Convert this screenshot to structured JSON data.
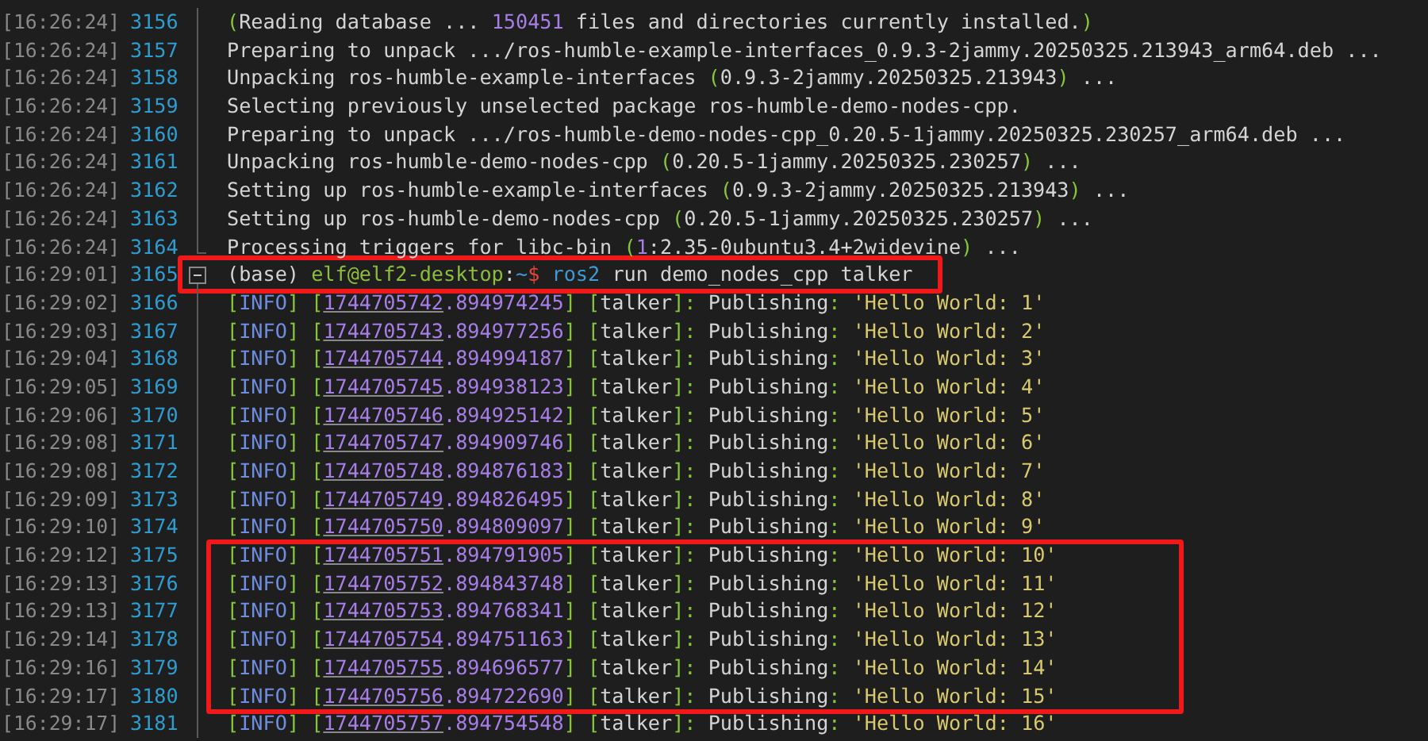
{
  "lines": [
    {
      "time": "[16:26:24]",
      "number": "3156",
      "kind": "plain",
      "segments": [
        {
          "kind": "punct",
          "text": "("
        },
        {
          "kind": "plain",
          "text": "Reading database ... "
        },
        {
          "kind": "number",
          "text": "150451"
        },
        {
          "kind": "plain",
          "text": " files and directories currently installed."
        },
        {
          "kind": "punct",
          "text": ")"
        }
      ]
    },
    {
      "time": "[16:26:24]",
      "number": "3157",
      "kind": "plain",
      "segments": [
        {
          "kind": "plain",
          "text": "Preparing to unpack .../ros-humble-example-interfaces_0.9.3-2jammy.20250325.213943_arm64.deb ..."
        }
      ]
    },
    {
      "time": "[16:26:24]",
      "number": "3158",
      "kind": "plain",
      "segments": [
        {
          "kind": "plain",
          "text": "Unpacking ros-humble-example-interfaces "
        },
        {
          "kind": "punct",
          "text": "("
        },
        {
          "kind": "plain",
          "text": "0.9.3-2jammy.20250325.213943"
        },
        {
          "kind": "punct",
          "text": ")"
        },
        {
          "kind": "plain",
          "text": " ..."
        }
      ]
    },
    {
      "time": "[16:26:24]",
      "number": "3159",
      "kind": "plain",
      "segments": [
        {
          "kind": "plain",
          "text": "Selecting previously unselected package ros-humble-demo-nodes-cpp."
        }
      ]
    },
    {
      "time": "[16:26:24]",
      "number": "3160",
      "kind": "plain",
      "segments": [
        {
          "kind": "plain",
          "text": "Preparing to unpack .../ros-humble-demo-nodes-cpp_0.20.5-1jammy.20250325.230257_arm64.deb ..."
        }
      ]
    },
    {
      "time": "[16:26:24]",
      "number": "3161",
      "kind": "plain",
      "segments": [
        {
          "kind": "plain",
          "text": "Unpacking ros-humble-demo-nodes-cpp "
        },
        {
          "kind": "punct",
          "text": "("
        },
        {
          "kind": "plain",
          "text": "0.20.5-1jammy.20250325.230257"
        },
        {
          "kind": "punct",
          "text": ")"
        },
        {
          "kind": "plain",
          "text": " ..."
        }
      ]
    },
    {
      "time": "[16:26:24]",
      "number": "3162",
      "kind": "plain",
      "segments": [
        {
          "kind": "plain",
          "text": "Setting up ros-humble-example-interfaces "
        },
        {
          "kind": "punct",
          "text": "("
        },
        {
          "kind": "plain",
          "text": "0.9.3-2jammy.20250325.213943"
        },
        {
          "kind": "punct",
          "text": ")"
        },
        {
          "kind": "plain",
          "text": " ..."
        }
      ]
    },
    {
      "time": "[16:26:24]",
      "number": "3163",
      "kind": "plain",
      "segments": [
        {
          "kind": "plain",
          "text": "Setting up ros-humble-demo-nodes-cpp "
        },
        {
          "kind": "punct",
          "text": "("
        },
        {
          "kind": "plain",
          "text": "0.20.5-1jammy.20250325.230257"
        },
        {
          "kind": "punct",
          "text": ")"
        },
        {
          "kind": "plain",
          "text": " ..."
        }
      ]
    },
    {
      "time": "[16:26:24]",
      "number": "3164",
      "kind": "closing",
      "segments": [
        {
          "kind": "plain",
          "text": "Processing triggers for libc-bin "
        },
        {
          "kind": "punct",
          "text": "("
        },
        {
          "kind": "number",
          "text": "1"
        },
        {
          "kind": "plain",
          "text": ":2.35-0ubuntu3.4+2widevine"
        },
        {
          "kind": "punct",
          "text": ")"
        },
        {
          "kind": "plain",
          "text": " ..."
        }
      ]
    },
    {
      "time": "[16:29:01]",
      "number": "3165",
      "kind": "opening",
      "segments": [
        {
          "kind": "plain",
          "text": "(base) "
        },
        {
          "kind": "user",
          "text": "elf@elf2-desktop"
        },
        {
          "kind": "plain",
          "text": ":"
        },
        {
          "kind": "command",
          "text": "~"
        },
        {
          "kind": "dollar",
          "text": "$ "
        },
        {
          "kind": "command",
          "text": "ros2"
        },
        {
          "kind": "plain",
          "text": " run demo_nodes_cpp talker"
        }
      ]
    },
    {
      "time": "[16:29:02]",
      "number": "3166",
      "kind": "plain",
      "segments": [
        {
          "kind": "punct",
          "text": "["
        },
        {
          "kind": "info",
          "text": "INFO"
        },
        {
          "kind": "punct",
          "text": "] ["
        },
        {
          "kind": "link",
          "text": "1744705742"
        },
        {
          "kind": "number",
          "text": ".894974245"
        },
        {
          "kind": "punct",
          "text": "] ["
        },
        {
          "kind": "plain",
          "text": "talker"
        },
        {
          "kind": "punct",
          "text": "]:"
        },
        {
          "kind": "plain",
          "text": " Publishing"
        },
        {
          "kind": "punct",
          "text": ": "
        },
        {
          "kind": "string",
          "text": "'Hello World: 1'"
        }
      ]
    },
    {
      "time": "[16:29:03]",
      "number": "3167",
      "kind": "plain",
      "segments": [
        {
          "kind": "punct",
          "text": "["
        },
        {
          "kind": "info",
          "text": "INFO"
        },
        {
          "kind": "punct",
          "text": "] ["
        },
        {
          "kind": "link",
          "text": "1744705743"
        },
        {
          "kind": "number",
          "text": ".894977256"
        },
        {
          "kind": "punct",
          "text": "] ["
        },
        {
          "kind": "plain",
          "text": "talker"
        },
        {
          "kind": "punct",
          "text": "]:"
        },
        {
          "kind": "plain",
          "text": " Publishing"
        },
        {
          "kind": "punct",
          "text": ": "
        },
        {
          "kind": "string",
          "text": "'Hello World: 2'"
        }
      ]
    },
    {
      "time": "[16:29:04]",
      "number": "3168",
      "kind": "plain",
      "segments": [
        {
          "kind": "punct",
          "text": "["
        },
        {
          "kind": "info",
          "text": "INFO"
        },
        {
          "kind": "punct",
          "text": "] ["
        },
        {
          "kind": "link",
          "text": "1744705744"
        },
        {
          "kind": "number",
          "text": ".894994187"
        },
        {
          "kind": "punct",
          "text": "] ["
        },
        {
          "kind": "plain",
          "text": "talker"
        },
        {
          "kind": "punct",
          "text": "]:"
        },
        {
          "kind": "plain",
          "text": " Publishing"
        },
        {
          "kind": "punct",
          "text": ": "
        },
        {
          "kind": "string",
          "text": "'Hello World: 3'"
        }
      ]
    },
    {
      "time": "[16:29:05]",
      "number": "3169",
      "kind": "plain",
      "segments": [
        {
          "kind": "punct",
          "text": "["
        },
        {
          "kind": "info",
          "text": "INFO"
        },
        {
          "kind": "punct",
          "text": "] ["
        },
        {
          "kind": "link",
          "text": "1744705745"
        },
        {
          "kind": "number",
          "text": ".894938123"
        },
        {
          "kind": "punct",
          "text": "] ["
        },
        {
          "kind": "plain",
          "text": "talker"
        },
        {
          "kind": "punct",
          "text": "]:"
        },
        {
          "kind": "plain",
          "text": " Publishing"
        },
        {
          "kind": "punct",
          "text": ": "
        },
        {
          "kind": "string",
          "text": "'Hello World: 4'"
        }
      ]
    },
    {
      "time": "[16:29:06]",
      "number": "3170",
      "kind": "plain",
      "segments": [
        {
          "kind": "punct",
          "text": "["
        },
        {
          "kind": "info",
          "text": "INFO"
        },
        {
          "kind": "punct",
          "text": "] ["
        },
        {
          "kind": "link",
          "text": "1744705746"
        },
        {
          "kind": "number",
          "text": ".894925142"
        },
        {
          "kind": "punct",
          "text": "] ["
        },
        {
          "kind": "plain",
          "text": "talker"
        },
        {
          "kind": "punct",
          "text": "]:"
        },
        {
          "kind": "plain",
          "text": " Publishing"
        },
        {
          "kind": "punct",
          "text": ": "
        },
        {
          "kind": "string",
          "text": "'Hello World: 5'"
        }
      ]
    },
    {
      "time": "[16:29:08]",
      "number": "3171",
      "kind": "plain",
      "segments": [
        {
          "kind": "punct",
          "text": "["
        },
        {
          "kind": "info",
          "text": "INFO"
        },
        {
          "kind": "punct",
          "text": "] ["
        },
        {
          "kind": "link",
          "text": "1744705747"
        },
        {
          "kind": "number",
          "text": ".894909746"
        },
        {
          "kind": "punct",
          "text": "] ["
        },
        {
          "kind": "plain",
          "text": "talker"
        },
        {
          "kind": "punct",
          "text": "]:"
        },
        {
          "kind": "plain",
          "text": " Publishing"
        },
        {
          "kind": "punct",
          "text": ": "
        },
        {
          "kind": "string",
          "text": "'Hello World: 6'"
        }
      ]
    },
    {
      "time": "[16:29:08]",
      "number": "3172",
      "kind": "plain",
      "segments": [
        {
          "kind": "punct",
          "text": "["
        },
        {
          "kind": "info",
          "text": "INFO"
        },
        {
          "kind": "punct",
          "text": "] ["
        },
        {
          "kind": "link",
          "text": "1744705748"
        },
        {
          "kind": "number",
          "text": ".894876183"
        },
        {
          "kind": "punct",
          "text": "] ["
        },
        {
          "kind": "plain",
          "text": "talker"
        },
        {
          "kind": "punct",
          "text": "]:"
        },
        {
          "kind": "plain",
          "text": " Publishing"
        },
        {
          "kind": "punct",
          "text": ": "
        },
        {
          "kind": "string",
          "text": "'Hello World: 7'"
        }
      ]
    },
    {
      "time": "[16:29:09]",
      "number": "3173",
      "kind": "plain",
      "segments": [
        {
          "kind": "punct",
          "text": "["
        },
        {
          "kind": "info",
          "text": "INFO"
        },
        {
          "kind": "punct",
          "text": "] ["
        },
        {
          "kind": "link",
          "text": "1744705749"
        },
        {
          "kind": "number",
          "text": ".894826495"
        },
        {
          "kind": "punct",
          "text": "] ["
        },
        {
          "kind": "plain",
          "text": "talker"
        },
        {
          "kind": "punct",
          "text": "]:"
        },
        {
          "kind": "plain",
          "text": " Publishing"
        },
        {
          "kind": "punct",
          "text": ": "
        },
        {
          "kind": "string",
          "text": "'Hello World: 8'"
        }
      ]
    },
    {
      "time": "[16:29:10]",
      "number": "3174",
      "kind": "plain",
      "segments": [
        {
          "kind": "punct",
          "text": "["
        },
        {
          "kind": "info",
          "text": "INFO"
        },
        {
          "kind": "punct",
          "text": "] ["
        },
        {
          "kind": "link",
          "text": "1744705750"
        },
        {
          "kind": "number",
          "text": ".894809097"
        },
        {
          "kind": "punct",
          "text": "] ["
        },
        {
          "kind": "plain",
          "text": "talker"
        },
        {
          "kind": "punct",
          "text": "]:"
        },
        {
          "kind": "plain",
          "text": " Publishing"
        },
        {
          "kind": "punct",
          "text": ": "
        },
        {
          "kind": "string",
          "text": "'Hello World: 9'"
        }
      ]
    },
    {
      "time": "[16:29:12]",
      "number": "3175",
      "kind": "plain",
      "segments": [
        {
          "kind": "punct",
          "text": "["
        },
        {
          "kind": "info",
          "text": "INFO"
        },
        {
          "kind": "punct",
          "text": "] ["
        },
        {
          "kind": "link",
          "text": "1744705751"
        },
        {
          "kind": "number",
          "text": ".894791905"
        },
        {
          "kind": "punct",
          "text": "] ["
        },
        {
          "kind": "plain",
          "text": "talker"
        },
        {
          "kind": "punct",
          "text": "]:"
        },
        {
          "kind": "plain",
          "text": " Publishing"
        },
        {
          "kind": "punct",
          "text": ": "
        },
        {
          "kind": "string",
          "text": "'Hello World: 10'"
        }
      ]
    },
    {
      "time": "[16:29:13]",
      "number": "3176",
      "kind": "plain",
      "segments": [
        {
          "kind": "punct",
          "text": "["
        },
        {
          "kind": "info",
          "text": "INFO"
        },
        {
          "kind": "punct",
          "text": "] ["
        },
        {
          "kind": "link",
          "text": "1744705752"
        },
        {
          "kind": "number",
          "text": ".894843748"
        },
        {
          "kind": "punct",
          "text": "] ["
        },
        {
          "kind": "plain",
          "text": "talker"
        },
        {
          "kind": "punct",
          "text": "]:"
        },
        {
          "kind": "plain",
          "text": " Publishing"
        },
        {
          "kind": "punct",
          "text": ": "
        },
        {
          "kind": "string",
          "text": "'Hello World: 11'"
        }
      ]
    },
    {
      "time": "[16:29:13]",
      "number": "3177",
      "kind": "plain",
      "segments": [
        {
          "kind": "punct",
          "text": "["
        },
        {
          "kind": "info",
          "text": "INFO"
        },
        {
          "kind": "punct",
          "text": "] ["
        },
        {
          "kind": "link",
          "text": "1744705753"
        },
        {
          "kind": "number",
          "text": ".894768341"
        },
        {
          "kind": "punct",
          "text": "] ["
        },
        {
          "kind": "plain",
          "text": "talker"
        },
        {
          "kind": "punct",
          "text": "]:"
        },
        {
          "kind": "plain",
          "text": " Publishing"
        },
        {
          "kind": "punct",
          "text": ": "
        },
        {
          "kind": "string",
          "text": "'Hello World: 12'"
        }
      ]
    },
    {
      "time": "[16:29:14]",
      "number": "3178",
      "kind": "plain",
      "segments": [
        {
          "kind": "punct",
          "text": "["
        },
        {
          "kind": "info",
          "text": "INFO"
        },
        {
          "kind": "punct",
          "text": "] ["
        },
        {
          "kind": "link",
          "text": "1744705754"
        },
        {
          "kind": "number",
          "text": ".894751163"
        },
        {
          "kind": "punct",
          "text": "] ["
        },
        {
          "kind": "plain",
          "text": "talker"
        },
        {
          "kind": "punct",
          "text": "]:"
        },
        {
          "kind": "plain",
          "text": " Publishing"
        },
        {
          "kind": "punct",
          "text": ": "
        },
        {
          "kind": "string",
          "text": "'Hello World: 13'"
        }
      ]
    },
    {
      "time": "[16:29:16]",
      "number": "3179",
      "kind": "plain",
      "segments": [
        {
          "kind": "punct",
          "text": "["
        },
        {
          "kind": "info",
          "text": "INFO"
        },
        {
          "kind": "punct",
          "text": "] ["
        },
        {
          "kind": "link",
          "text": "1744705755"
        },
        {
          "kind": "number",
          "text": ".894696577"
        },
        {
          "kind": "punct",
          "text": "] ["
        },
        {
          "kind": "plain",
          "text": "talker"
        },
        {
          "kind": "punct",
          "text": "]:"
        },
        {
          "kind": "plain",
          "text": " Publishing"
        },
        {
          "kind": "punct",
          "text": ": "
        },
        {
          "kind": "string",
          "text": "'Hello World: 14'"
        }
      ]
    },
    {
      "time": "[16:29:17]",
      "number": "3180",
      "kind": "plain",
      "segments": [
        {
          "kind": "punct",
          "text": "["
        },
        {
          "kind": "info",
          "text": "INFO"
        },
        {
          "kind": "punct",
          "text": "] ["
        },
        {
          "kind": "link",
          "text": "1744705756"
        },
        {
          "kind": "number",
          "text": ".894722690"
        },
        {
          "kind": "punct",
          "text": "] ["
        },
        {
          "kind": "plain",
          "text": "talker"
        },
        {
          "kind": "punct",
          "text": "]:"
        },
        {
          "kind": "plain",
          "text": " Publishing"
        },
        {
          "kind": "punct",
          "text": ": "
        },
        {
          "kind": "string",
          "text": "'Hello World: 15'"
        }
      ]
    },
    {
      "time": "[16:29:17]",
      "number": "3181",
      "kind": "plain",
      "segments": [
        {
          "kind": "punct",
          "text": "["
        },
        {
          "kind": "info",
          "text": "INFO"
        },
        {
          "kind": "punct",
          "text": "] ["
        },
        {
          "kind": "link",
          "text": "1744705757"
        },
        {
          "kind": "number",
          "text": ".894754548"
        },
        {
          "kind": "punct",
          "text": "] ["
        },
        {
          "kind": "plain",
          "text": "talker"
        },
        {
          "kind": "punct",
          "text": "]:"
        },
        {
          "kind": "plain",
          "text": " Publishing"
        },
        {
          "kind": "punct",
          "text": ": "
        },
        {
          "kind": "string",
          "text": "'Hello World: 16'"
        }
      ]
    }
  ]
}
